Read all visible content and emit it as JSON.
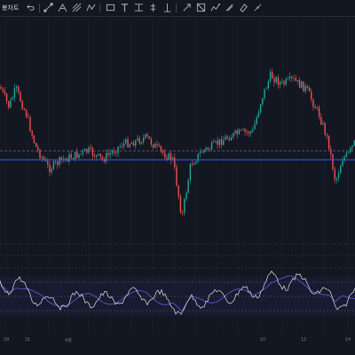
{
  "toolbar": {
    "interval_label": "봉차트",
    "tools": [
      {
        "name": "undo-icon"
      },
      {
        "name": "trend-line-icon"
      },
      {
        "name": "fib-icon"
      },
      {
        "name": "pitchfork-icon"
      },
      {
        "name": "path-icon"
      },
      {
        "name": "rectangle-icon"
      },
      {
        "name": "text-icon"
      },
      {
        "name": "price-range-icon"
      },
      {
        "name": "vertical-line-icon"
      },
      {
        "name": "arrow-icon"
      },
      {
        "name": "brush-icon"
      },
      {
        "name": "shapes-icon"
      },
      {
        "name": "pattern-icon"
      },
      {
        "name": "measure-icon"
      },
      {
        "name": "eraser-icon"
      },
      {
        "name": "more-icon"
      }
    ]
  },
  "colors": {
    "background": "#131722",
    "up": "#26a69a",
    "down": "#ef5350",
    "horizontal_line": "#2962ff",
    "dashed_level": "#7e57c2",
    "indicator_fast": "#e0e3eb",
    "indicator_slow": "#5c5fe0"
  },
  "time_axis": {
    "labels": [
      "29",
      "31",
      "",
      "4월",
      "",
      "",
      "",
      "",
      "",
      "10",
      "",
      "12",
      "",
      "14"
    ]
  }
}
